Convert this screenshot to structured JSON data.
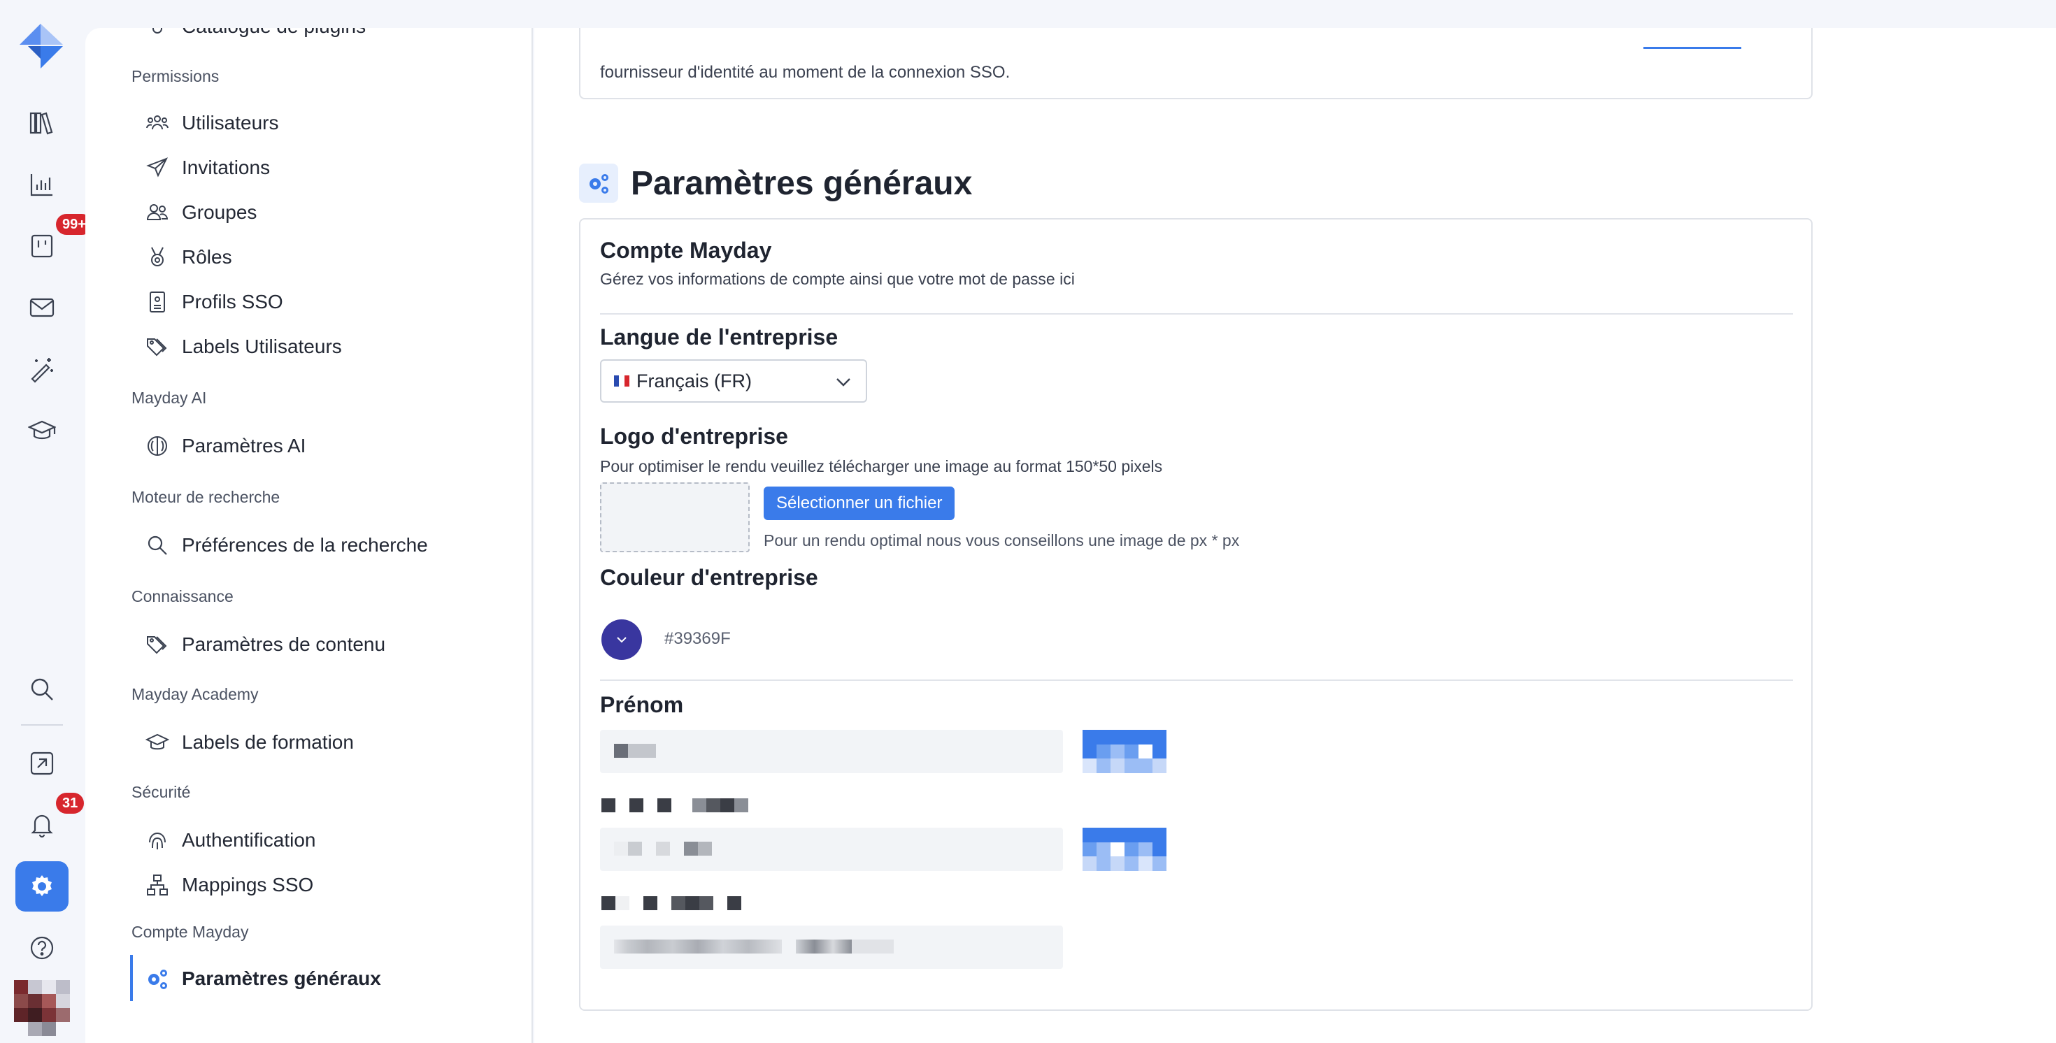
{
  "rail": {
    "badges": {
      "notifications_tasks": "99+",
      "alerts": "31"
    }
  },
  "sidebar": {
    "top_cut_item": "Catalogue de plugins",
    "sections": {
      "permissions": "Permissions",
      "mayday_ai": "Mayday AI",
      "search_engine": "Moteur de recherche",
      "knowledge": "Connaissance",
      "academy": "Mayday Academy",
      "security": "Sécurité",
      "account": "Compte Mayday"
    },
    "items": {
      "users": "Utilisateurs",
      "invitations": "Invitations",
      "groups": "Groupes",
      "roles": "Rôles",
      "sso_profiles": "Profils SSO",
      "user_labels": "Labels Utilisateurs",
      "ai_settings": "Paramètres AI",
      "search_prefs": "Préférences de la recherche",
      "content_settings": "Paramètres de contenu",
      "training_labels": "Labels de formation",
      "authentication": "Authentification",
      "sso_mappings": "Mappings SSO",
      "general_settings": "Paramètres généraux"
    }
  },
  "main": {
    "top_card_text": "fournisseur d'identité au moment de la connexion SSO.",
    "page_title": "Paramètres généraux",
    "account": {
      "title": "Compte Mayday",
      "subtitle": "Gérez vos informations de compte ainsi que votre mot de passe ici"
    },
    "language": {
      "title": "Langue de l'entreprise",
      "value": "Français (FR)"
    },
    "logo": {
      "title": "Logo d'entreprise",
      "subtitle": "Pour optimiser le rendu veuillez télécharger une image au format 150*50 pixels",
      "button": "Sélectionner un fichier",
      "hint": "Pour un rendu optimal nous vous conseillons une image de px * px"
    },
    "color": {
      "title": "Couleur d'entreprise",
      "value": "#39369F"
    },
    "firstname": {
      "title": "Prénom"
    }
  }
}
